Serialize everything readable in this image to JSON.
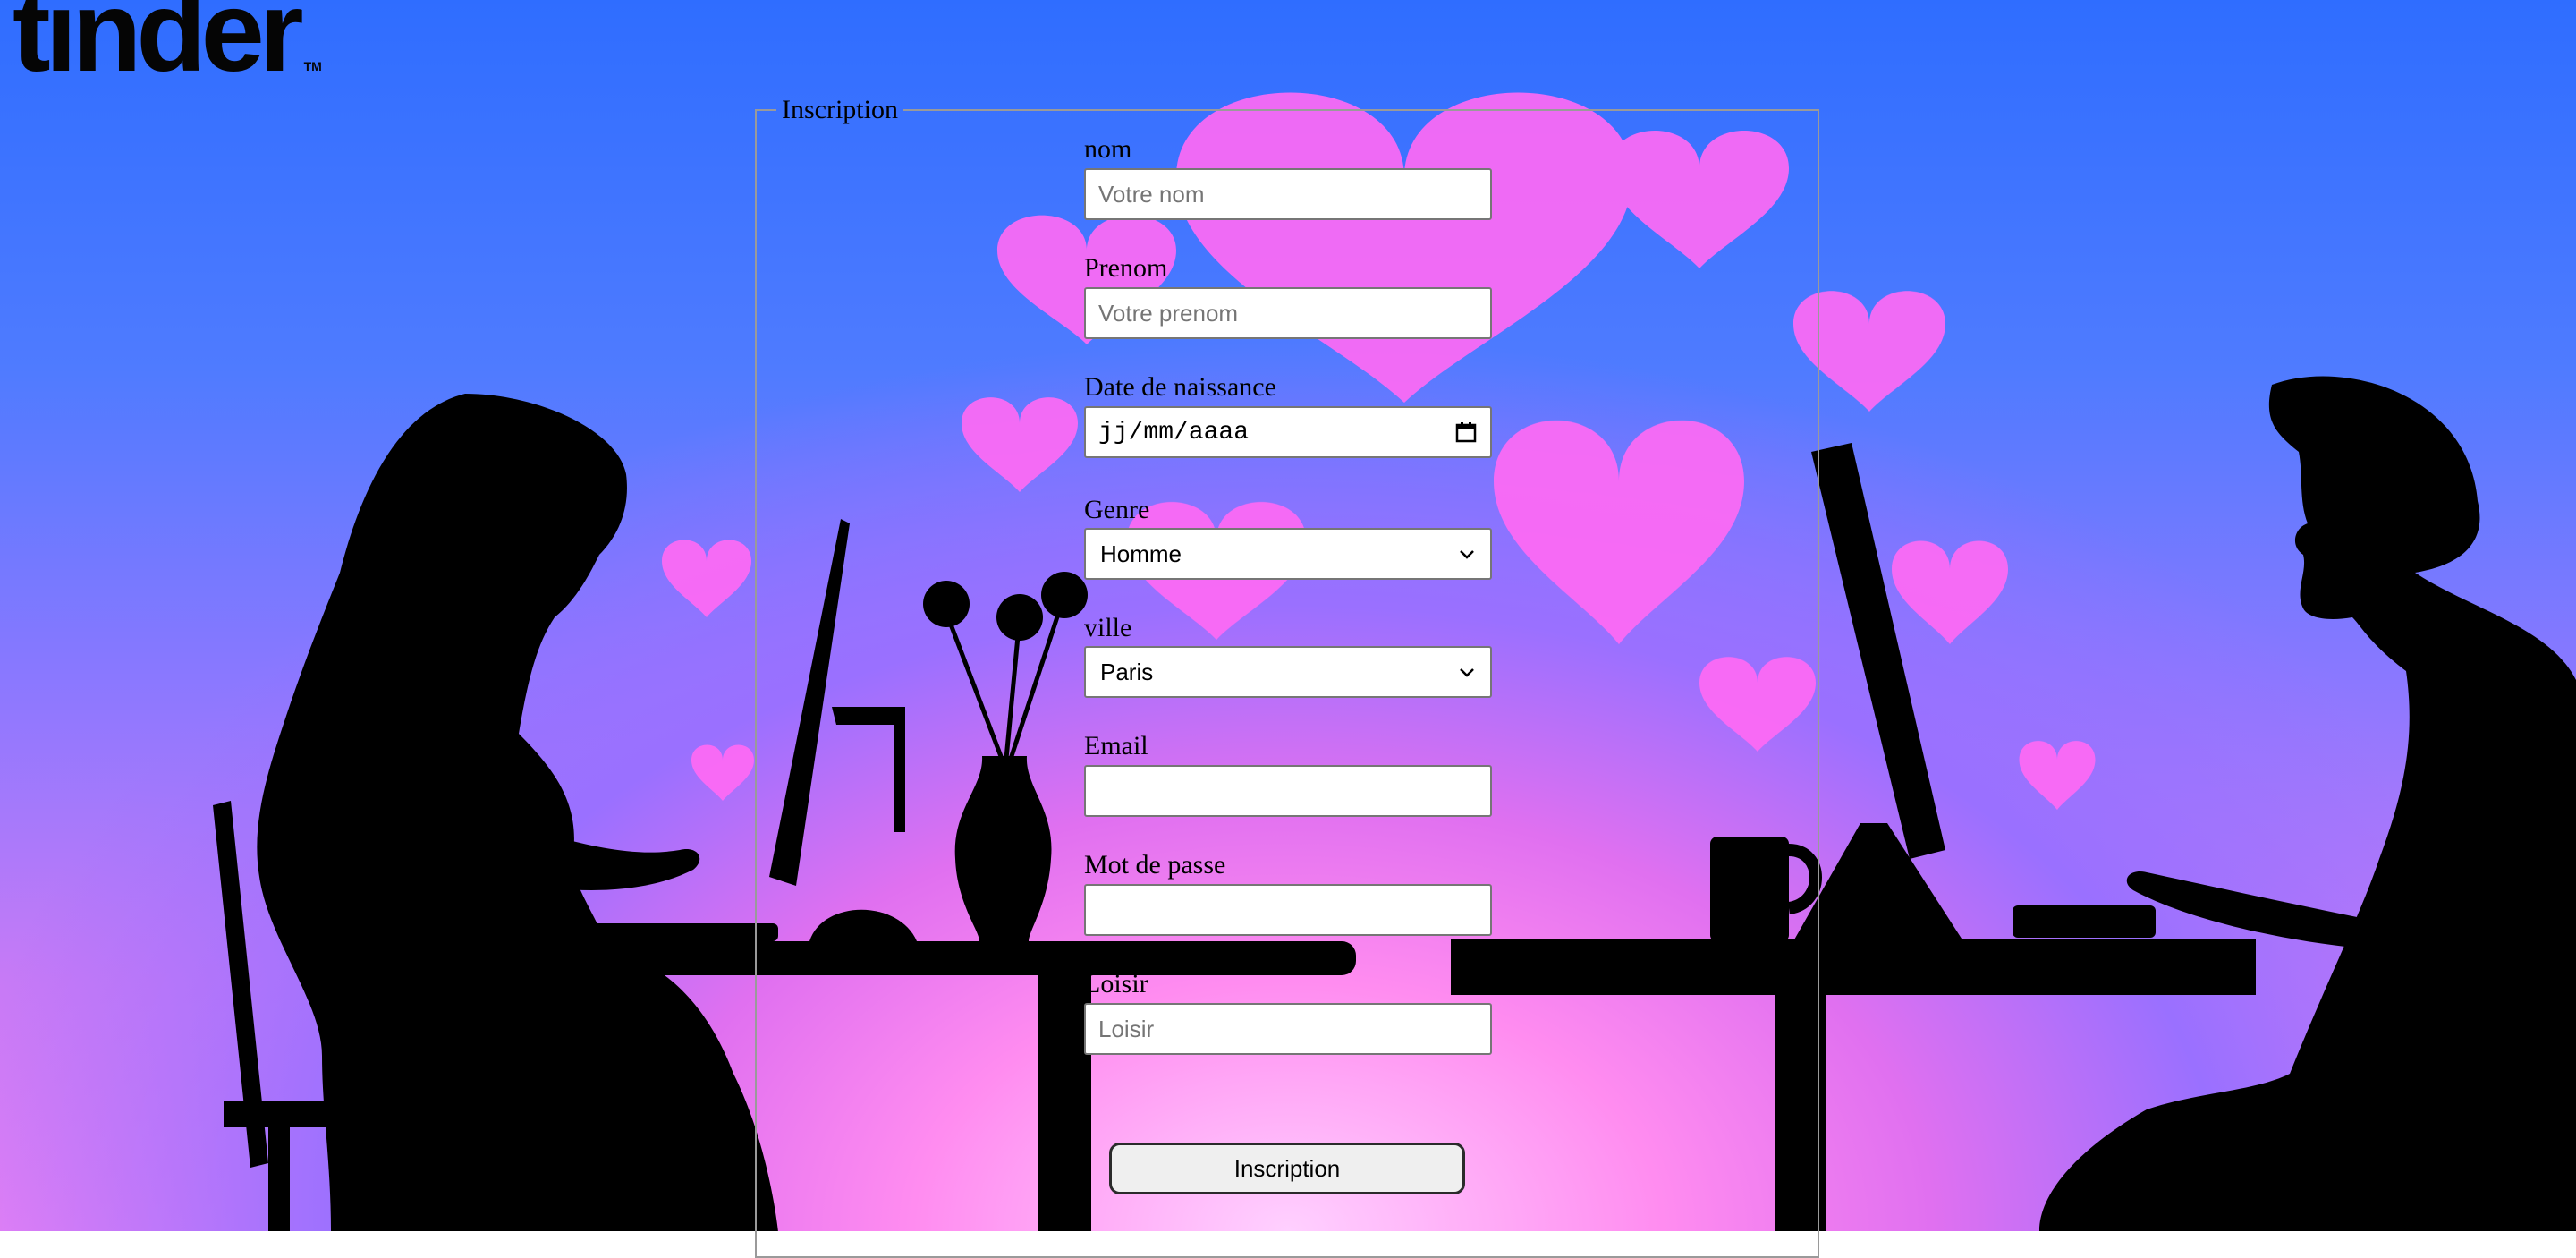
{
  "logo": {
    "text": "tinder",
    "tm": "TM"
  },
  "form": {
    "legend": "Inscription",
    "nom": {
      "label": "nom",
      "placeholder": "Votre nom"
    },
    "prenom": {
      "label": "Prenom",
      "placeholder": "Votre prenom"
    },
    "naissance": {
      "label": "Date de naissance",
      "value": "jj/mm/aaaa"
    },
    "genre": {
      "label": "Genre",
      "value": "Homme"
    },
    "ville": {
      "label": "ville",
      "value": "Paris"
    },
    "email": {
      "label": "Email",
      "placeholder": ""
    },
    "motdepasse": {
      "label": "Mot de passe",
      "placeholder": ""
    },
    "loisir": {
      "label": "Loisir",
      "placeholder": "Loisir"
    },
    "submit_label": "Inscription"
  },
  "colors": {
    "sky_top": "#2f6dff",
    "glow": "#ff8cf0",
    "hearts": "#ff6af5",
    "silhouette": "#000000"
  },
  "icons": {
    "calendar": "calendar-icon",
    "chevron": "chevron-down-icon"
  }
}
